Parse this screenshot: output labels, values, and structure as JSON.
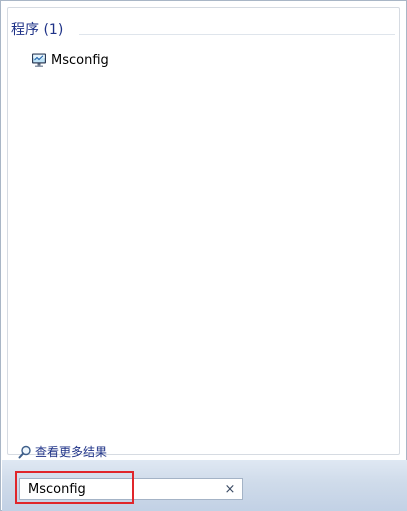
{
  "results": {
    "section_title": "程序 (1)",
    "items": [
      {
        "label": "Msconfig",
        "icon": "msconfig-monitor-icon"
      }
    ]
  },
  "more_results": {
    "label": "查看更多结果",
    "icon": "search-icon"
  },
  "search": {
    "value": "Msconfig",
    "clear_glyph": "×"
  },
  "colors": {
    "header_text": "#1e3287",
    "highlight": "#e0262b",
    "footer_top": "#dfe8f3",
    "footer_bottom": "#c2d1e5"
  }
}
